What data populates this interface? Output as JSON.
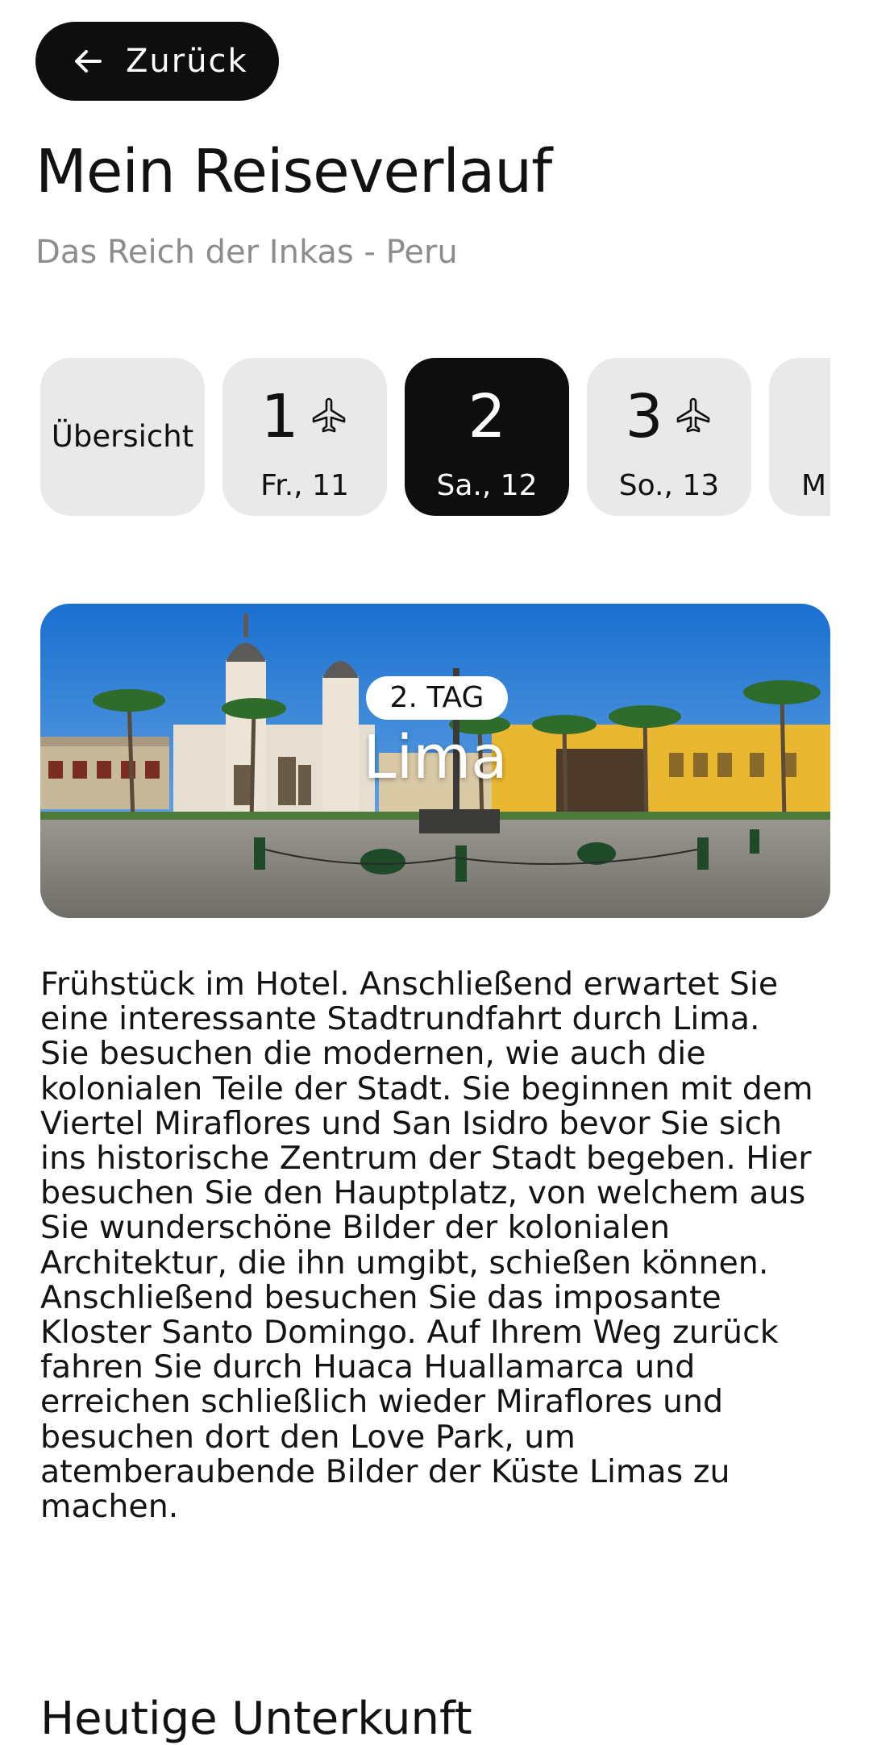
{
  "back_button": {
    "label": "Zurück",
    "icon": "arrow-left-icon"
  },
  "header": {
    "title": "Mein Reiseverlauf",
    "subtitle": "Das Reich der Inkas - Peru"
  },
  "day_tabs": [
    {
      "label": "Übersicht",
      "type": "overview",
      "active": false
    },
    {
      "number": "1",
      "date": "Fr., 11",
      "flight": true,
      "active": false
    },
    {
      "number": "2",
      "date": "Sa., 12",
      "flight": false,
      "active": true
    },
    {
      "number": "3",
      "date": "So., 13",
      "flight": true,
      "active": false
    },
    {
      "number": "",
      "date": "M",
      "flight": false,
      "active": false
    }
  ],
  "hero": {
    "badge": "2. TAG",
    "city": "Lima"
  },
  "description": "Frühstück im Hotel. Anschließend erwartet Sie eine interessante Stadtrundfahrt durch Lima. Sie besuchen die modernen, wie auch die kolonialen Teile der Stadt. Sie beginnen mit dem Viertel Miraflores und San Isidro bevor Sie sich ins historische Zentrum der Stadt begeben. Hier besuchen Sie den Hauptplatz, von welchem aus Sie wunderschöne Bilder der kolonialen Architektur, die ihn umgibt, schießen können. Anschließend besuchen Sie das imposante Kloster Santo Domingo. Auf Ihrem Weg zurück fahren Sie durch Huaca Huallamarca und erreichen schließlich wieder Miraflores und besuchen dort den Love Park, um atemberaubende Bilder der Küste Limas zu machen.",
  "section": {
    "heading": "Heutige Unterkunft"
  },
  "colors": {
    "dark": "#0e0e0e",
    "chip": "#e9e9e9",
    "muted": "#8d8d8d"
  }
}
